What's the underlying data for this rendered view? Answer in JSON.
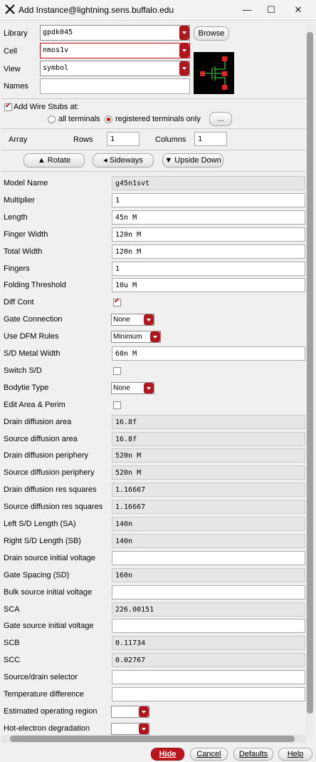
{
  "window": {
    "title": "Add Instance@lightning.sens.buffalo.edu"
  },
  "top": {
    "library_label": "Library",
    "library_value": "gpdk045",
    "browse_label": "Browse",
    "cell_label": "Cell",
    "cell_value": "nmos1v",
    "view_label": "View",
    "view_value": "symbol",
    "names_label": "Names",
    "names_value": ""
  },
  "stubs": {
    "label": "Add Wire Stubs at:",
    "all_terminals": "all terminals",
    "registered_only": "registered terminals only",
    "more_button": "...",
    "checked": true,
    "selected": "registered"
  },
  "array": {
    "label": "Array",
    "rows_label": "Rows",
    "rows_value": "1",
    "columns_label": "Columns",
    "columns_value": "1"
  },
  "transform": {
    "rotate": "Rotate",
    "sideways": "Sideways",
    "upside_down": "Upside Down"
  },
  "params": [
    {
      "label": "Model Name",
      "type": "ro",
      "value": "g45n1svt"
    },
    {
      "label": "Multiplier",
      "type": "input",
      "value": "1"
    },
    {
      "label": "Length",
      "type": "input",
      "value": "45n M"
    },
    {
      "label": "Finger Width",
      "type": "input",
      "value": "120n M"
    },
    {
      "label": "Total Width",
      "type": "input",
      "value": "120n M"
    },
    {
      "label": "Fingers",
      "type": "input",
      "value": "1"
    },
    {
      "label": "Folding Threshold",
      "type": "input",
      "value": "10u M"
    },
    {
      "label": "Diff Cont",
      "type": "check",
      "value": true
    },
    {
      "label": "Gate Connection",
      "type": "dd",
      "value": "None"
    },
    {
      "label": "Use DFM Rules",
      "type": "dd",
      "value": "Minimum"
    },
    {
      "label": "S/D Metal Width",
      "type": "input",
      "value": "60n M"
    },
    {
      "label": "Switch S/D",
      "type": "check",
      "value": false
    },
    {
      "label": "Bodytie Type",
      "type": "dd",
      "value": "None"
    },
    {
      "label": "Edit Area & Perim",
      "type": "check",
      "value": false
    },
    {
      "label": "Drain diffusion area",
      "type": "ro",
      "value": "16.8f"
    },
    {
      "label": "Source diffusion area",
      "type": "ro",
      "value": "16.8f"
    },
    {
      "label": "Drain diffusion periphery",
      "type": "ro",
      "value": "520n M"
    },
    {
      "label": "Source diffusion periphery",
      "type": "ro",
      "value": "520n M"
    },
    {
      "label": "Drain diffusion res squares",
      "type": "ro",
      "value": "1.16667"
    },
    {
      "label": "Source diffusion res squares",
      "type": "ro",
      "value": "1.16667"
    },
    {
      "label": "Left S/D Length (SA)",
      "type": "ro",
      "value": "140n"
    },
    {
      "label": "Right S/D Length (SB)",
      "type": "ro",
      "value": "140n"
    },
    {
      "label": "Drain source initial voltage",
      "type": "input",
      "value": ""
    },
    {
      "label": "Gate Spacing (SD)",
      "type": "ro",
      "value": "160n"
    },
    {
      "label": "Bulk source initial voltage",
      "type": "input",
      "value": ""
    },
    {
      "label": "SCA",
      "type": "ro",
      "value": "226.00151"
    },
    {
      "label": "Gate source initial voltage",
      "type": "input",
      "value": ""
    },
    {
      "label": "SCB",
      "type": "ro",
      "value": "0.11734"
    },
    {
      "label": "SCC",
      "type": "ro",
      "value": "0.02767"
    },
    {
      "label": "Source/drain selector",
      "type": "input",
      "value": ""
    },
    {
      "label": "Temperature difference",
      "type": "input",
      "value": ""
    },
    {
      "label": "Estimated operating region",
      "type": "dd",
      "value": ""
    },
    {
      "label": "Hot-electron degradation",
      "type": "dd",
      "value": ""
    }
  ],
  "buttons": {
    "hide": "Hide",
    "cancel": "Cancel",
    "defaults": "Defaults",
    "help": "Help"
  },
  "colors": {
    "accent": "#c0141c"
  }
}
